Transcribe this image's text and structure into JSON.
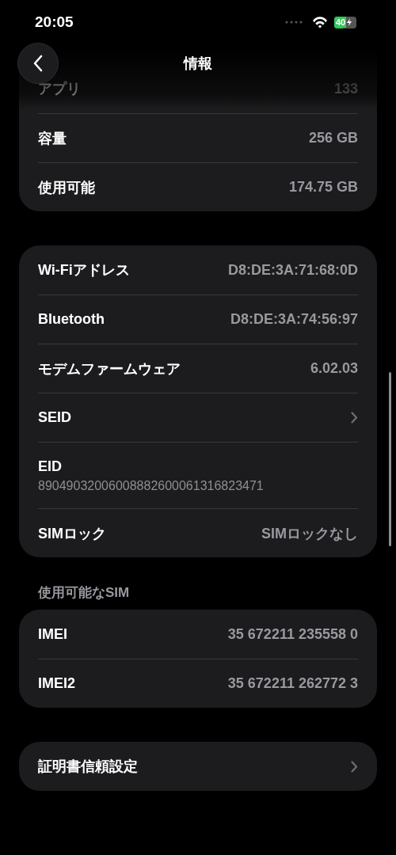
{
  "status_bar": {
    "time": "20:05",
    "battery": "40",
    "charging": true
  },
  "nav": {
    "title": "情報"
  },
  "groups": [
    {
      "cut_top": true,
      "rows": [
        {
          "kind": "value",
          "label": "アプリ",
          "value": "133"
        },
        {
          "kind": "value",
          "label": "容量",
          "value": "256 GB"
        },
        {
          "kind": "value",
          "label": "使用可能",
          "value": "174.75 GB"
        }
      ]
    },
    {
      "rows": [
        {
          "kind": "value",
          "label": "Wi-Fiアドレス",
          "value": "D8:DE:3A:71:68:0D"
        },
        {
          "kind": "value",
          "label": "Bluetooth",
          "value": "D8:DE:3A:74:56:97"
        },
        {
          "kind": "value",
          "label": "モデムファームウェア",
          "value": "6.02.03"
        },
        {
          "kind": "link",
          "label": "SEID"
        },
        {
          "kind": "stacked",
          "label": "EID",
          "value": "89049032006008882600061316823471"
        },
        {
          "kind": "value",
          "label": "SIMロック",
          "value": "SIMロックなし"
        }
      ]
    },
    {
      "header": "使用可能なSIM",
      "rows": [
        {
          "kind": "value",
          "label": "IMEI",
          "value": "35 672211 235558 0"
        },
        {
          "kind": "value",
          "label": "IMEI2",
          "value": "35 672211 262772 3"
        }
      ]
    },
    {
      "rows": [
        {
          "kind": "link",
          "label": "証明書信頼設定"
        }
      ]
    }
  ]
}
